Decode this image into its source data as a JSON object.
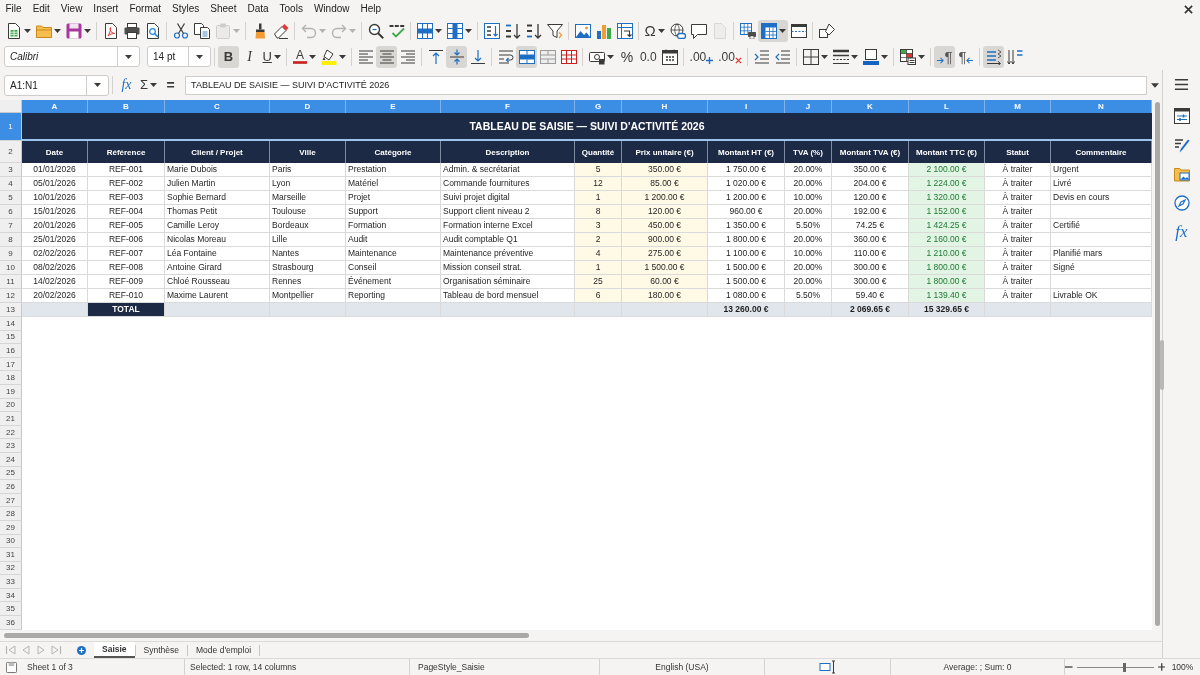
{
  "menu_bar": {
    "items": [
      "File",
      "Edit",
      "View",
      "Insert",
      "Format",
      "Styles",
      "Sheet",
      "Data",
      "Tools",
      "Window",
      "Help"
    ]
  },
  "standard_toolbar": {
    "groups": [
      [
        {
          "on": false,
          "disabled": false,
          "menu": true
        },
        {
          "on": false,
          "disabled": false,
          "menu": true
        },
        {
          "on": false,
          "disabled": false,
          "menu": true
        }
      ],
      [
        {
          "on": false,
          "disabled": false,
          "menu": false
        },
        {
          "on": false,
          "disabled": false,
          "menu": false
        },
        {
          "on": false,
          "disabled": false,
          "menu": false
        }
      ],
      [
        {
          "on": false,
          "disabled": false,
          "menu": false
        },
        {
          "on": false,
          "disabled": false,
          "menu": false
        },
        {
          "on": false,
          "disabled": true,
          "menu": true
        }
      ],
      [
        {
          "on": false,
          "disabled": false,
          "menu": false
        },
        {
          "on": false,
          "disabled": false,
          "menu": false
        }
      ],
      [
        {
          "on": false,
          "disabled": true,
          "menu": true
        },
        {
          "on": false,
          "disabled": true,
          "menu": true
        }
      ],
      [
        {
          "on": false,
          "disabled": false,
          "menu": false
        },
        {
          "on": false,
          "disabled": false,
          "menu": false
        }
      ],
      [
        {
          "on": false,
          "disabled": false,
          "menu": true
        },
        {
          "on": false,
          "disabled": false,
          "menu": true
        }
      ],
      [
        {
          "on": false,
          "disabled": false,
          "menu": false
        },
        {
          "on": false,
          "disabled": false,
          "menu": false
        },
        {
          "on": false,
          "disabled": false,
          "menu": false
        },
        {
          "on": false,
          "disabled": false,
          "menu": false
        }
      ],
      [
        {
          "on": false,
          "disabled": false,
          "menu": false
        },
        {
          "on": false,
          "disabled": false,
          "menu": false
        },
        {
          "on": false,
          "disabled": false,
          "menu": false
        }
      ],
      [
        {
          "label": "Ω",
          "on": false,
          "disabled": false,
          "menu": true
        },
        {
          "on": false,
          "disabled": false,
          "menu": false
        },
        {
          "on": false,
          "disabled": false,
          "menu": false
        },
        {
          "on": false,
          "disabled": true,
          "menu": false
        }
      ],
      [
        {
          "on": false,
          "disabled": false,
          "menu": false
        },
        {
          "on": true,
          "disabled": false,
          "menu": true
        },
        {
          "on": false,
          "disabled": false,
          "menu": false
        }
      ],
      [
        {
          "on": false,
          "disabled": false,
          "menu": false
        }
      ]
    ]
  },
  "formatting_toolbar": {
    "font_name": "Calibri",
    "font_size": "14 pt",
    "groups": [
      [
        {
          "label": "B",
          "on": true,
          "disabled": false,
          "menu": false
        },
        {
          "label": "I",
          "on": false,
          "disabled": false,
          "menu": false
        },
        {
          "label": "U",
          "on": false,
          "disabled": false,
          "menu": true
        }
      ],
      [
        {
          "label": "A",
          "on": false,
          "disabled": false,
          "menu": true
        },
        {
          "on": false,
          "disabled": false,
          "menu": true
        }
      ],
      [
        {
          "on": false,
          "disabled": false,
          "menu": false
        },
        {
          "on": true,
          "disabled": false,
          "menu": false
        },
        {
          "on": false,
          "disabled": false,
          "menu": false
        }
      ],
      [
        {
          "on": false,
          "disabled": false,
          "menu": false
        },
        {
          "on": true,
          "disabled": false,
          "menu": false
        },
        {
          "on": false,
          "disabled": false,
          "menu": false
        }
      ],
      [
        {
          "on": false,
          "disabled": false,
          "menu": false
        },
        {
          "on": true,
          "disabled": false,
          "menu": false
        },
        {
          "on": false,
          "disabled": false,
          "menu": false
        },
        {
          "on": false,
          "disabled": false,
          "menu": false
        }
      ],
      [
        {
          "on": false,
          "disabled": false,
          "menu": true
        },
        {
          "label": "%",
          "on": false,
          "disabled": false,
          "menu": false
        },
        {
          "label": "0.0",
          "on": false,
          "disabled": false,
          "menu": false
        },
        {
          "on": false,
          "disabled": false,
          "menu": false
        }
      ],
      [
        {
          "label": ".00",
          "on": false,
          "disabled": false,
          "menu": false
        },
        {
          "label": ".00",
          "on": false,
          "disabled": false,
          "menu": false
        }
      ],
      [
        {
          "on": false,
          "disabled": false,
          "menu": false
        },
        {
          "on": false,
          "disabled": false,
          "menu": false
        }
      ],
      [
        {
          "on": false,
          "disabled": false,
          "menu": true
        },
        {
          "on": false,
          "disabled": false,
          "menu": true
        },
        {
          "on": false,
          "disabled": false,
          "menu": true
        }
      ],
      [
        {
          "on": false,
          "disabled": false,
          "menu": true
        }
      ],
      [
        {
          "label": "¶",
          "on": true,
          "disabled": false,
          "menu": false
        },
        {
          "label": "¶",
          "on": false,
          "disabled": false,
          "menu": false
        }
      ],
      [
        {
          "on": true,
          "disabled": false,
          "menu": false
        },
        {
          "on": false,
          "disabled": false,
          "menu": false
        }
      ]
    ]
  },
  "formula_bar": {
    "name_box": "A1:N1",
    "buttons": [
      {
        "label": "fx",
        "menu": false
      },
      {
        "label": "Σ",
        "menu": true
      },
      {
        "label": "=",
        "menu": false
      }
    ],
    "content": "TABLEAU DE SAISIE — SUIVI D'ACTIVITÉ 2026"
  },
  "sheet": {
    "columns": [
      {
        "letter": "A",
        "selected": true
      },
      {
        "letter": "B",
        "selected": true
      },
      {
        "letter": "C",
        "selected": true
      },
      {
        "letter": "D",
        "selected": true
      },
      {
        "letter": "E",
        "selected": true
      },
      {
        "letter": "F",
        "selected": true
      },
      {
        "letter": "G",
        "selected": true
      },
      {
        "letter": "H",
        "selected": true
      },
      {
        "letter": "I",
        "selected": true
      },
      {
        "letter": "J",
        "selected": true
      },
      {
        "letter": "K",
        "selected": true
      },
      {
        "letter": "L",
        "selected": true
      },
      {
        "letter": "M",
        "selected": true
      },
      {
        "letter": "N",
        "selected": true
      }
    ],
    "row_numbers": [
      {
        "number": "1",
        "selected": true
      },
      {
        "number": "2",
        "selected": false
      },
      {
        "number": "3",
        "selected": false
      },
      {
        "number": "4",
        "selected": false
      },
      {
        "number": "5",
        "selected": false
      },
      {
        "number": "6",
        "selected": false
      },
      {
        "number": "7",
        "selected": false
      },
      {
        "number": "8",
        "selected": false
      },
      {
        "number": "9",
        "selected": false
      },
      {
        "number": "10",
        "selected": false
      },
      {
        "number": "11",
        "selected": false
      },
      {
        "number": "12",
        "selected": false
      },
      {
        "number": "13",
        "selected": false
      },
      {
        "number": "14",
        "selected": false
      },
      {
        "number": "15",
        "selected": false
      },
      {
        "number": "16",
        "selected": false
      },
      {
        "number": "17",
        "selected": false
      },
      {
        "number": "18",
        "selected": false
      },
      {
        "number": "19",
        "selected": false
      },
      {
        "number": "20",
        "selected": false
      },
      {
        "number": "21",
        "selected": false
      },
      {
        "number": "22",
        "selected": false
      },
      {
        "number": "23",
        "selected": false
      },
      {
        "number": "24",
        "selected": false
      },
      {
        "number": "25",
        "selected": false
      },
      {
        "number": "26",
        "selected": false
      },
      {
        "number": "27",
        "selected": false
      },
      {
        "number": "28",
        "selected": false
      },
      {
        "number": "29",
        "selected": false
      },
      {
        "number": "30",
        "selected": false
      },
      {
        "number": "31",
        "selected": false
      },
      {
        "number": "32",
        "selected": false
      },
      {
        "number": "33",
        "selected": false
      },
      {
        "number": "34",
        "selected": false
      },
      {
        "number": "35",
        "selected": false
      },
      {
        "number": "36",
        "selected": false
      }
    ],
    "title": "TABLEAU DE SAISIE — SUIVI D'ACTIVITÉ 2026",
    "headers": [
      "Date",
      "Référence",
      "Client / Projet",
      "Ville",
      "Catégorie",
      "Description",
      "Quantité",
      "Prix unitaire (€)",
      "Montant HT (€)",
      "TVA (%)",
      "Montant TVA (€)",
      "Montant TTC (€)",
      "Statut",
      "Commentaire"
    ],
    "rows": [
      {
        "date": "01/01/2026",
        "reference": "REF-001",
        "client": "Marie Dubois",
        "city": "Paris",
        "category": "Prestation",
        "description": "Admin. & secrétariat",
        "quantity": "5",
        "unit_price": "350.00 €",
        "amount_ht": "1 750.00 €",
        "vat_rate": "20.00%",
        "vat_amount": "350.00 €",
        "amount_ttc": "2 100.00 €",
        "status": "À traiter",
        "comment": "Urgent"
      },
      {
        "date": "05/01/2026",
        "reference": "REF-002",
        "client": "Julien Martin",
        "city": "Lyon",
        "category": "Matériel",
        "description": "Commande fournitures",
        "quantity": "12",
        "unit_price": "85.00 €",
        "amount_ht": "1 020.00 €",
        "vat_rate": "20.00%",
        "vat_amount": "204.00 €",
        "amount_ttc": "1 224.00 €",
        "status": "À traiter",
        "comment": "Livré"
      },
      {
        "date": "10/01/2026",
        "reference": "REF-003",
        "client": "Sophie Bernard",
        "city": "Marseille",
        "category": "Projet",
        "description": "Suivi projet digital",
        "quantity": "1",
        "unit_price": "1 200.00 €",
        "amount_ht": "1 200.00 €",
        "vat_rate": "10.00%",
        "vat_amount": "120.00 €",
        "amount_ttc": "1 320.00 €",
        "status": "À traiter",
        "comment": "Devis en cours"
      },
      {
        "date": "15/01/2026",
        "reference": "REF-004",
        "client": "Thomas Petit",
        "city": "Toulouse",
        "category": "Support",
        "description": "Support client niveau 2",
        "quantity": "8",
        "unit_price": "120.00 €",
        "amount_ht": "960.00 €",
        "vat_rate": "20.00%",
        "vat_amount": "192.00 €",
        "amount_ttc": "1 152.00 €",
        "status": "À traiter"
      },
      {
        "date": "20/01/2026",
        "reference": "REF-005",
        "client": "Camille Leroy",
        "city": "Bordeaux",
        "category": "Formation",
        "description": "Formation interne Excel",
        "quantity": "3",
        "unit_price": "450.00 €",
        "amount_ht": "1 350.00 €",
        "vat_rate": "5.50%",
        "vat_amount": "74.25 €",
        "amount_ttc": "1 424.25 €",
        "status": "À traiter",
        "comment": "Certifié"
      },
      {
        "date": "25/01/2026",
        "reference": "REF-006",
        "client": "Nicolas Moreau",
        "city": "Lille",
        "category": "Audit",
        "description": "Audit comptable Q1",
        "quantity": "2",
        "unit_price": "900.00 €",
        "amount_ht": "1 800.00 €",
        "vat_rate": "20.00%",
        "vat_amount": "360.00 €",
        "amount_ttc": "2 160.00 €",
        "status": "À traiter"
      },
      {
        "date": "02/02/2026",
        "reference": "REF-007",
        "client": "Léa Fontaine",
        "city": "Nantes",
        "category": "Maintenance",
        "description": "Maintenance préventive",
        "quantity": "4",
        "unit_price": "275.00 €",
        "amount_ht": "1 100.00 €",
        "vat_rate": "10.00%",
        "vat_amount": "110.00 €",
        "amount_ttc": "1 210.00 €",
        "status": "À traiter",
        "comment": "Planifié mars"
      },
      {
        "date": "08/02/2026",
        "reference": "REF-008",
        "client": "Antoine Girard",
        "city": "Strasbourg",
        "category": "Conseil",
        "description": "Mission conseil strat.",
        "quantity": "1",
        "unit_price": "1 500.00 €",
        "amount_ht": "1 500.00 €",
        "vat_rate": "20.00%",
        "vat_amount": "300.00 €",
        "amount_ttc": "1 800.00 €",
        "status": "À traiter",
        "comment": "Signé"
      },
      {
        "date": "14/02/2026",
        "reference": "REF-009",
        "client": "Chloé Rousseau",
        "city": "Rennes",
        "category": "Événement",
        "description": "Organisation séminaire",
        "quantity": "25",
        "unit_price": "60.00 €",
        "amount_ht": "1 500.00 €",
        "vat_rate": "20.00%",
        "vat_amount": "300.00 €",
        "amount_ttc": "1 800.00 €",
        "status": "À traiter"
      },
      {
        "date": "20/02/2026",
        "reference": "REF-010",
        "client": "Maxime Laurent",
        "city": "Montpellier",
        "category": "Reporting",
        "description": "Tableau de bord mensuel",
        "quantity": "6",
        "unit_price": "180.00 €",
        "amount_ht": "1 080.00 €",
        "vat_rate": "5.50%",
        "vat_amount": "59.40 €",
        "amount_ttc": "1 139.40 €",
        "status": "À traiter",
        "comment": "Livrable OK"
      }
    ],
    "total": {
      "label": "TOTAL",
      "amount_ht": "13 260.00 €",
      "vat_amount": "2 069.65 €",
      "amount_ttc": "15 329.65 €"
    }
  },
  "sheet_tabs": [
    {
      "label": "Saisie",
      "selected": true
    },
    {
      "label": "Synthèse",
      "selected": false
    },
    {
      "label": "Mode d'emploi",
      "selected": false
    }
  ],
  "sidebar": {
    "functions_tab": "fx"
  },
  "status_bar": {
    "sheet": "Sheet 1 of 3",
    "selection": "Selected: 1 row, 14 columns",
    "page_style": "PageStyle_Saisie",
    "language": "English (USA)",
    "summary": "Average: ; Sum: 0",
    "zoom": {
      "label": "100%",
      "level": 0.62
    }
  }
}
